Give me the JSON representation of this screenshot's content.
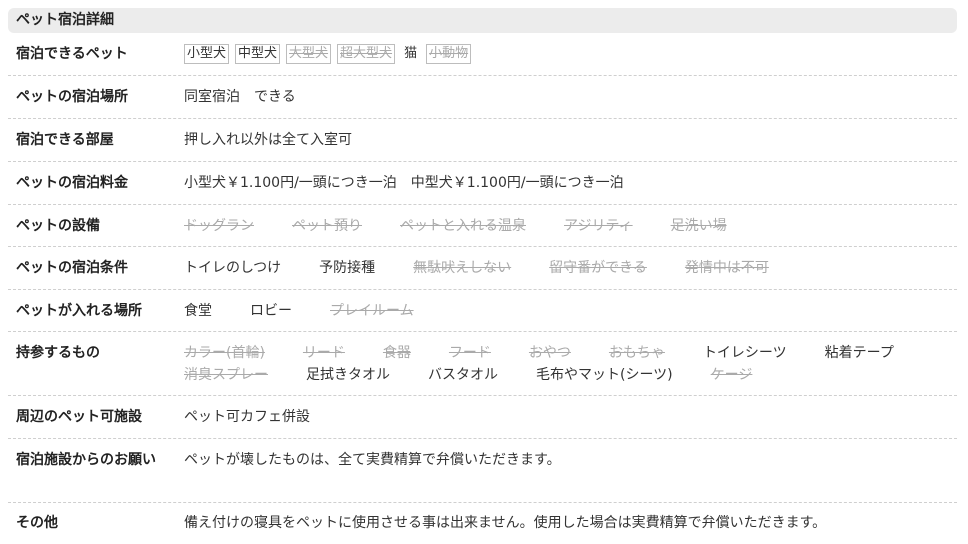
{
  "title": "ペット宿泊詳細",
  "rows": {
    "pets": {
      "label": "宿泊できるペット",
      "items": [
        {
          "text": "小型犬",
          "active": true
        },
        {
          "text": "中型犬",
          "active": true
        },
        {
          "text": "大型犬",
          "active": false
        },
        {
          "text": "超大型犬",
          "active": false
        },
        {
          "text": "猫",
          "active": true
        },
        {
          "text": "小動物",
          "active": false
        }
      ]
    },
    "place": {
      "label": "ペットの宿泊場所",
      "value": "同室宿泊　できる"
    },
    "rooms": {
      "label": "宿泊できる部屋",
      "value": "押し入れ以外は全て入室可"
    },
    "fee": {
      "label": "ペットの宿泊料金",
      "value": "小型犬￥1.100円/一頭につき一泊　中型犬￥1.100円/一頭につき一泊"
    },
    "facilities": {
      "label": "ペットの設備",
      "items": [
        {
          "text": "ドッグラン",
          "active": false
        },
        {
          "text": "ペット預り",
          "active": false
        },
        {
          "text": "ペットと入れる温泉",
          "active": false
        },
        {
          "text": "アジリティ",
          "active": false
        },
        {
          "text": "足洗い場",
          "active": false
        }
      ]
    },
    "conditions": {
      "label": "ペットの宿泊条件",
      "items": [
        {
          "text": "トイレのしつけ",
          "active": true
        },
        {
          "text": "予防接種",
          "active": true
        },
        {
          "text": "無駄吠えしない",
          "active": false
        },
        {
          "text": "留守番ができる",
          "active": false
        },
        {
          "text": "発情中は不可",
          "active": false
        }
      ]
    },
    "areas": {
      "label": "ペットが入れる場所",
      "items": [
        {
          "text": "食堂",
          "active": true
        },
        {
          "text": "ロビー",
          "active": true
        },
        {
          "text": "プレイルーム",
          "active": false
        }
      ]
    },
    "bring": {
      "label": "持参するもの",
      "line1": [
        {
          "text": "カラー(首輪)",
          "active": false
        },
        {
          "text": "リード",
          "active": false
        },
        {
          "text": "食器",
          "active": false
        },
        {
          "text": "フード",
          "active": false
        },
        {
          "text": "おやつ",
          "active": false
        },
        {
          "text": "おもちゃ",
          "active": false
        },
        {
          "text": "トイレシーツ",
          "active": true
        },
        {
          "text": "粘着テープ",
          "active": true
        }
      ],
      "line2": [
        {
          "text": "消臭スプレー",
          "active": false
        },
        {
          "text": "足拭きタオル",
          "active": true
        },
        {
          "text": "バスタオル",
          "active": true
        },
        {
          "text": "毛布やマット(シーツ)",
          "active": true
        },
        {
          "text": "ケージ",
          "active": false
        }
      ]
    },
    "nearby": {
      "label": "周辺のペット可施設",
      "value": "ペット可カフェ併設"
    },
    "request": {
      "label": "宿泊施設からのお願い",
      "value": "ペットが壊したものは、全て実費精算で弁償いただきます。"
    },
    "other": {
      "label": "その他",
      "value": "備え付けの寝具をペットに使用させる事は出来ません。使用した場合は実費精算で弁償いただきます。"
    }
  }
}
